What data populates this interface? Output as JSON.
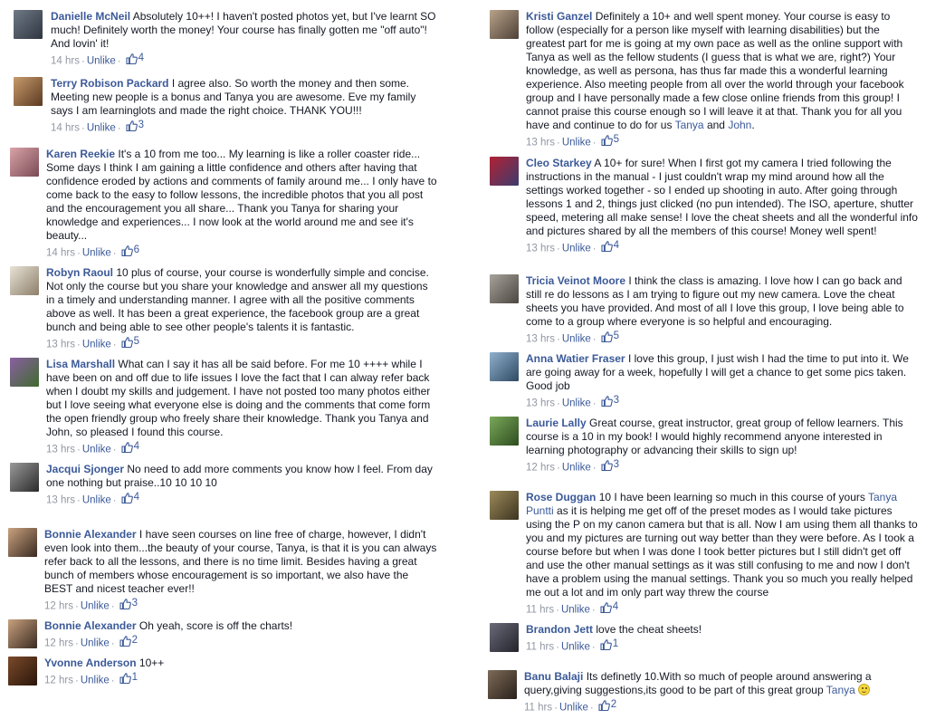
{
  "colors": {
    "link": "#3b5998",
    "meta": "#9197a3",
    "text": "#141823"
  },
  "actions": {
    "unlike": "Unlike",
    "separator": "·"
  },
  "icons": {
    "like": "thumbs-up-icon",
    "emoticon": "smiley-icon"
  },
  "left": [
    {
      "author": "Danielle McNeil",
      "text": "Absolutely 10++! I haven't posted photos yet, but I've learnt SO much! Definitely worth the money! Your course has finally gotten me \"off auto\"! And lovin' it!",
      "time": "14 hrs",
      "likes": "4",
      "avatar_colors": [
        "#6f7a86",
        "#2f3540"
      ]
    },
    {
      "author": "Terry Robison Packard",
      "text": "I agree also. So worth the money and then some. Meeting new people is a bonus and Tanya you are awesome. Eve my family says I am learninglots and made the right choice. THANK YOU!!!",
      "time": "14 hrs",
      "likes": "3",
      "avatar_colors": [
        "#c79a6b",
        "#5b3a22"
      ]
    },
    {
      "author": "Karen Reekie",
      "text": "It's a 10 from me too... My learning is like a roller coaster ride... Some days I think I am gaining a little confidence and others after having that confidence eroded by actions and comments of family around me... I only have to come back to the easy to follow lessons, the incredible photos that you all post and the encouragement you all share... Thank you Tanya for sharing your knowledge and experiences... I now look at the world around me and see it's beauty...",
      "time": "14 hrs",
      "likes": "6",
      "avatar_colors": [
        "#d9a3a8",
        "#7a4b55"
      ]
    },
    {
      "author": "Robyn Raoul",
      "text": "10 plus of course, your course is wonderfully simple and concise. Not only the course but you share your knowledge and answer all my questions in a timely and understanding manner. I agree with all the positive comments above as well. It has been a great experience, the facebook group are a great bunch and being able to see other people's talents it is fantastic.",
      "time": "13 hrs",
      "likes": "5",
      "avatar_colors": [
        "#e8e2d6",
        "#8d7f6a"
      ]
    },
    {
      "author": "Lisa Marshall",
      "text": "What can I say it has all be said before. For me 10 ++++ while I have been on and off due to life issues I love the fact that I can alway refer back when I doubt my skills and judgement. I have not posted too many photos either but I love seeing what everyone else is doing and the comments that come form the open friendly group who freely share their knowledge. Thank you Tanya and John, so pleased I found this course.",
      "time": "13 hrs",
      "likes": "4",
      "avatar_colors": [
        "#8a5fa3",
        "#3f6b2e"
      ]
    },
    {
      "author": "Jacqui Sjonger",
      "text": "No need to add more comments you know how I feel. From day one nothing but praise..10 10 10 10",
      "time": "13 hrs",
      "likes": "4",
      "avatar_colors": [
        "#9a9a9a",
        "#2a2a2a"
      ]
    },
    {
      "author": "Bonnie Alexander",
      "text": "I have seen courses on line free of charge, however, I didn't even look into them...the beauty of your course, Tanya, is that it is you can always refer back to all the lessons, and there is no time limit. Besides having a great bunch of members whose encouragement is so important, we also have the BEST and nicest teacher ever!!",
      "time": "12 hrs",
      "likes": "3",
      "avatar_colors": [
        "#c9a27e",
        "#3a2a22"
      ]
    },
    {
      "author": "Bonnie Alexander",
      "text": "Oh yeah, score is off the charts!",
      "time": "12 hrs",
      "likes": "2",
      "avatar_colors": [
        "#c9a27e",
        "#3a2a22"
      ]
    },
    {
      "author": "Yvonne Anderson",
      "text": "10++",
      "time": "12 hrs",
      "likes": "1",
      "avatar_colors": [
        "#7a4a2a",
        "#2b160b"
      ]
    }
  ],
  "right": [
    {
      "author": "Kristi Ganzel",
      "text_a": "Definitely a 10+ and well spent money. Your course is easy to follow (especially for a person like myself with learning disabilities) but the greatest part for me is going at my own pace as well as the online support with Tanya as well as the fellow students (I guess that is what we are, right?) Your knowledge, as well as persona, has thus far made this a wonderful learning experience. Also meeting people from all over the world through your facebook group and I have personally made a few close online friends from this group! I cannot praise this course enough so I will leave it at that. Thank you for all you have and continue to do for us ",
      "mention1": "Tanya",
      "text_b": " and ",
      "mention2": "John",
      "text_c": ".",
      "time": "13 hrs",
      "likes": "5",
      "avatar_colors": [
        "#b9a38a",
        "#4d4036"
      ]
    },
    {
      "author": "Cleo Starkey",
      "text": "A 10+ for sure! When I first got my camera I tried following the instructions in the manual - I just couldn't wrap my mind around how all the settings worked together - so I ended up shooting in auto. After going through lessons 1 and 2, things just clicked (no pun intended). The ISO, aperture, shutter speed, metering all make sense! I love the cheat sheets and all the wonderful info and pictures shared by all the members of this course! Money well spent!",
      "time": "13 hrs",
      "likes": "4",
      "avatar_colors": [
        "#b22234",
        "#3c3b6e"
      ]
    },
    {
      "author": "Tricia Veinot Moore",
      "text": "I think the class is amazing. I love how I can go back and still re do lessons as I am trying to figure out my new camera. Love the cheat sheets you have provided. And most of all I love this group, I love being able to come to a group where everyone is so helpful and encouraging.",
      "time": "13 hrs",
      "likes": "5",
      "avatar_colors": [
        "#a7a39b",
        "#4a4640"
      ]
    },
    {
      "author": "Anna Watier Fraser",
      "text": "I love this group, I just wish I had the time to put into it. We are going away for a week, hopefully I will get a chance to get some pics taken. Good job",
      "time": "13 hrs",
      "likes": "3",
      "avatar_colors": [
        "#8fb0cc",
        "#2f4a63"
      ]
    },
    {
      "author": "Laurie Lally",
      "text": "Great course, great instructor, great group of fellow learners. This course is a 10 in my book! I would highly recommend anyone interested in learning photography or advancing their skills to sign up!",
      "time": "12 hrs",
      "likes": "3",
      "avatar_colors": [
        "#7aa85a",
        "#2e4d1f"
      ]
    },
    {
      "author": "Rose Duggan",
      "text_a": "10 I have been learning so much in this course of yours ",
      "mention1": "Tanya Puntti",
      "text_b": " as it is helping me get off of the preset modes as I would take pictures using the P on my canon camera but that is all. Now I am using them all thanks to you and my pictures are turning out way better than they were before. As I took a course before but when I was done I took better pictures but I still didn't get off and use the other manual settings as it was still confusing to me and now I don't have a problem using the manual settings. Thank you so much you really helped me out a lot and im only part way threw the course",
      "time": "11 hrs",
      "likes": "4",
      "avatar_colors": [
        "#9c8a5a",
        "#3d3420"
      ]
    },
    {
      "author": "Brandon Jett",
      "text": "love the cheat sheets!",
      "time": "11 hrs",
      "likes": "1",
      "avatar_colors": [
        "#6a6a7a",
        "#23232b"
      ]
    },
    {
      "author": "Banu Balaji",
      "text_a": "Its definetly 10.With so much of people around answering a query,giving suggestions,its good to be part of this great group ",
      "mention1": "Tanya",
      "time": "11 hrs",
      "likes": "2",
      "avatar_colors": [
        "#7d6b58",
        "#2a211a"
      ]
    }
  ]
}
